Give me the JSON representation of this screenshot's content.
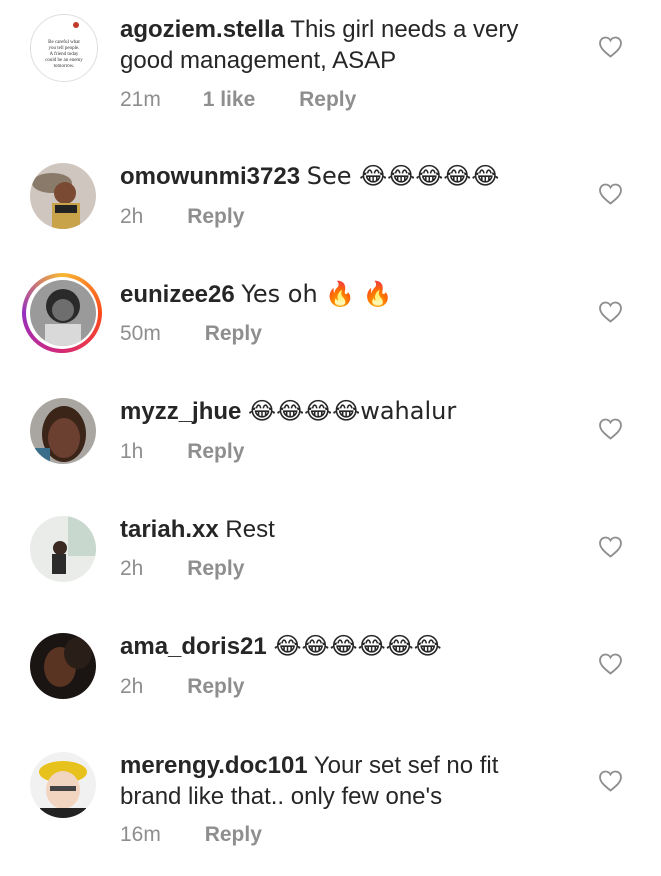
{
  "comments": [
    {
      "username": "agoziem.stella",
      "text": "This girl needs a very good management, ASAP",
      "time": "21m",
      "likes": "1 like",
      "reply": "Reply",
      "avatar": "quote-card"
    },
    {
      "username": "omowunmi3723",
      "text": "See 😂😂😂😂😂",
      "time": "2h",
      "likes": "",
      "reply": "Reply",
      "avatar": "photo"
    },
    {
      "username": "eunizee26",
      "text": "Yes oh 🔥 🔥",
      "time": "50m",
      "likes": "",
      "reply": "Reply",
      "avatar": "story-ring"
    },
    {
      "username": "myzz_jhue",
      "text": "😂😂😂😂wahalur",
      "time": "1h",
      "likes": "",
      "reply": "Reply",
      "avatar": "photo"
    },
    {
      "username": "tariah.xx",
      "text": "Rest",
      "time": "2h",
      "likes": "",
      "reply": "Reply",
      "avatar": "photo"
    },
    {
      "username": "ama_doris21",
      "text": "😂😂😂😂😂😂",
      "time": "2h",
      "likes": "",
      "reply": "Reply",
      "avatar": "photo"
    },
    {
      "username": "merengy.doc101",
      "text": "Your set sef no fit brand like that.. only few one's",
      "time": "16m",
      "likes": "",
      "reply": "Reply",
      "avatar": "memoji"
    }
  ],
  "quote_card_text": "Be careful what you tell people. A friend today could be an enemy tomorrow.",
  "icons": {
    "like": "heart-outline-icon"
  },
  "colors": {
    "text": "#262626",
    "meta": "#8e8e8e"
  }
}
